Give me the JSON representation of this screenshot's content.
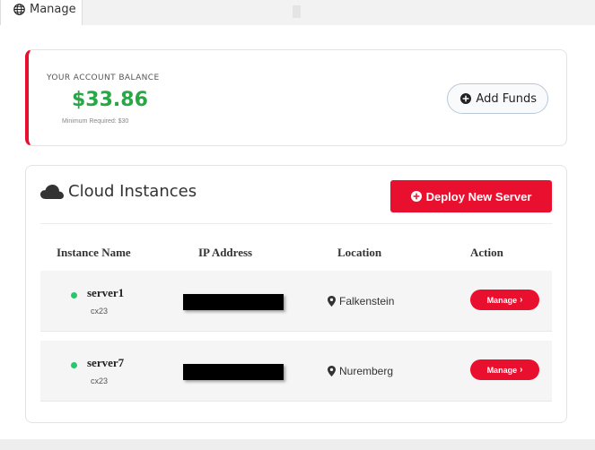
{
  "tab": {
    "label": "Manage"
  },
  "balance": {
    "label": "YOUR ACCOUNT BALANCE",
    "amount": "$33.86",
    "minimum": "Minimum Required: $30",
    "add_funds_label": "Add Funds"
  },
  "instances": {
    "title": "Cloud Instances",
    "deploy_label": "Deploy New Server",
    "columns": [
      "Instance Name",
      "IP Address",
      "Location",
      "Action"
    ],
    "rows": [
      {
        "name": "server1",
        "type": "cx23",
        "location": "Falkenstein",
        "action": "Manage",
        "status": "online"
      },
      {
        "name": "server7",
        "type": "cx23",
        "location": "Nuremberg",
        "action": "Manage",
        "status": "online"
      }
    ]
  },
  "colors": {
    "accent": "#e8102e",
    "balance": "#28a745",
    "status_online": "#28c76f"
  },
  "icons": {
    "tab": "globe-icon",
    "add_funds": "plus-circle-icon",
    "title": "cloud-icon",
    "deploy": "plus-circle-icon",
    "location": "map-pin-icon",
    "manage": "chevron-right-icon"
  }
}
